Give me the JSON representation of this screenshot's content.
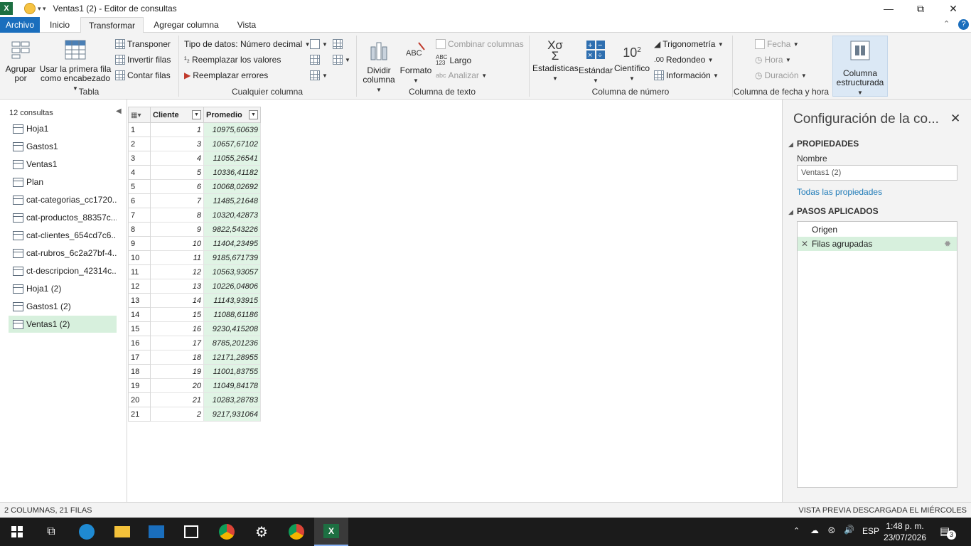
{
  "window": {
    "title": "Ventas1 (2) - Editor de consultas"
  },
  "tabs": [
    {
      "label": "Archivo"
    },
    {
      "label": "Inicio"
    },
    {
      "label": "Transformar"
    },
    {
      "label": "Agregar columna"
    },
    {
      "label": "Vista"
    }
  ],
  "ribbon": {
    "tabla": {
      "group_label": "Tabla",
      "agrupar": "Agrupar",
      "agrupar2": "por",
      "primera_fila": "Usar la primera fila",
      "primera_fila2": "como encabezado",
      "transponer": "Transponer",
      "invertir": "Invertir filas",
      "contar": "Contar filas"
    },
    "cualquier": {
      "group_label": "Cualquier columna",
      "tipo_datos": "Tipo de datos: Número decimal",
      "reemplazar_valores": "Reemplazar los valores",
      "reemplazar_errores": "Reemplazar errores"
    },
    "texto": {
      "group_label": "Columna de texto",
      "dividir": "Dividir",
      "dividir2": "columna",
      "formato": "Formato",
      "combinar": "Combinar columnas",
      "largo": "Largo",
      "analizar": "Analizar"
    },
    "numero": {
      "group_label": "Columna de número",
      "estadisticas": "Estadísticas",
      "estandar": "Estándar",
      "cientifico": "Científico",
      "trigonometria": "Trigonometría",
      "redondeo": "Redondeo",
      "informacion": "Información"
    },
    "fecha": {
      "group_label": "Columna de fecha y hora",
      "fecha": "Fecha",
      "hora": "Hora",
      "duracion": "Duración"
    },
    "estructurada": {
      "label1": "Columna",
      "label2": "estructurada"
    }
  },
  "queries": {
    "count_label": "12 consultas",
    "items": [
      "Hoja1",
      "Gastos1",
      "Ventas1",
      "Plan",
      "cat-categorias_cc1720...",
      "cat-productos_88357c...",
      "cat-clientes_654cd7c6...",
      "cat-rubros_6c2a27bf-4...",
      "ct-descripcion_42314c...",
      "Hoja1 (2)",
      "Gastos1 (2)",
      "Ventas1 (2)"
    ],
    "selected_index": 11
  },
  "grid": {
    "columns": [
      "Cliente",
      "Promedio"
    ],
    "rows": [
      [
        "1",
        "10975,60639"
      ],
      [
        "3",
        "10657,67102"
      ],
      [
        "4",
        "11055,26541"
      ],
      [
        "5",
        "10336,41182"
      ],
      [
        "6",
        "10068,02692"
      ],
      [
        "7",
        "11485,21648"
      ],
      [
        "8",
        "10320,42873"
      ],
      [
        "9",
        "9822,543226"
      ],
      [
        "10",
        "11404,23495"
      ],
      [
        "11",
        "9185,671739"
      ],
      [
        "12",
        "10563,93057"
      ],
      [
        "13",
        "10226,04806"
      ],
      [
        "14",
        "11143,93915"
      ],
      [
        "15",
        "11088,61186"
      ],
      [
        "16",
        "9230,415208"
      ],
      [
        "17",
        "8785,201236"
      ],
      [
        "18",
        "12171,28955"
      ],
      [
        "19",
        "11001,83755"
      ],
      [
        "20",
        "11049,84178"
      ],
      [
        "21",
        "10283,28783"
      ],
      [
        "2",
        "9217,931064"
      ]
    ]
  },
  "settings": {
    "title": "Configuración de la co...",
    "propiedades": "PROPIEDADES",
    "nombre_label": "Nombre",
    "nombre_value": "Ventas1 (2)",
    "todas_link": "Todas las propiedades",
    "pasos": "PASOS APLICADOS",
    "steps": [
      "Origen",
      "Filas agrupadas"
    ],
    "selected_step": 1
  },
  "status": {
    "left": "2 COLUMNAS, 21 FILAS",
    "right": "VISTA PREVIA DESCARGADA EL MIÉRCOLES"
  },
  "taskbar": {
    "lang": "ESP",
    "time": "1:48 p. m.",
    "date": "23/07/2026",
    "notif_count": "3"
  },
  "colors": {
    "file_tab": "#1a6ebd",
    "selected_green": "#d7f0dd",
    "excel_green": "#1d6f42"
  }
}
